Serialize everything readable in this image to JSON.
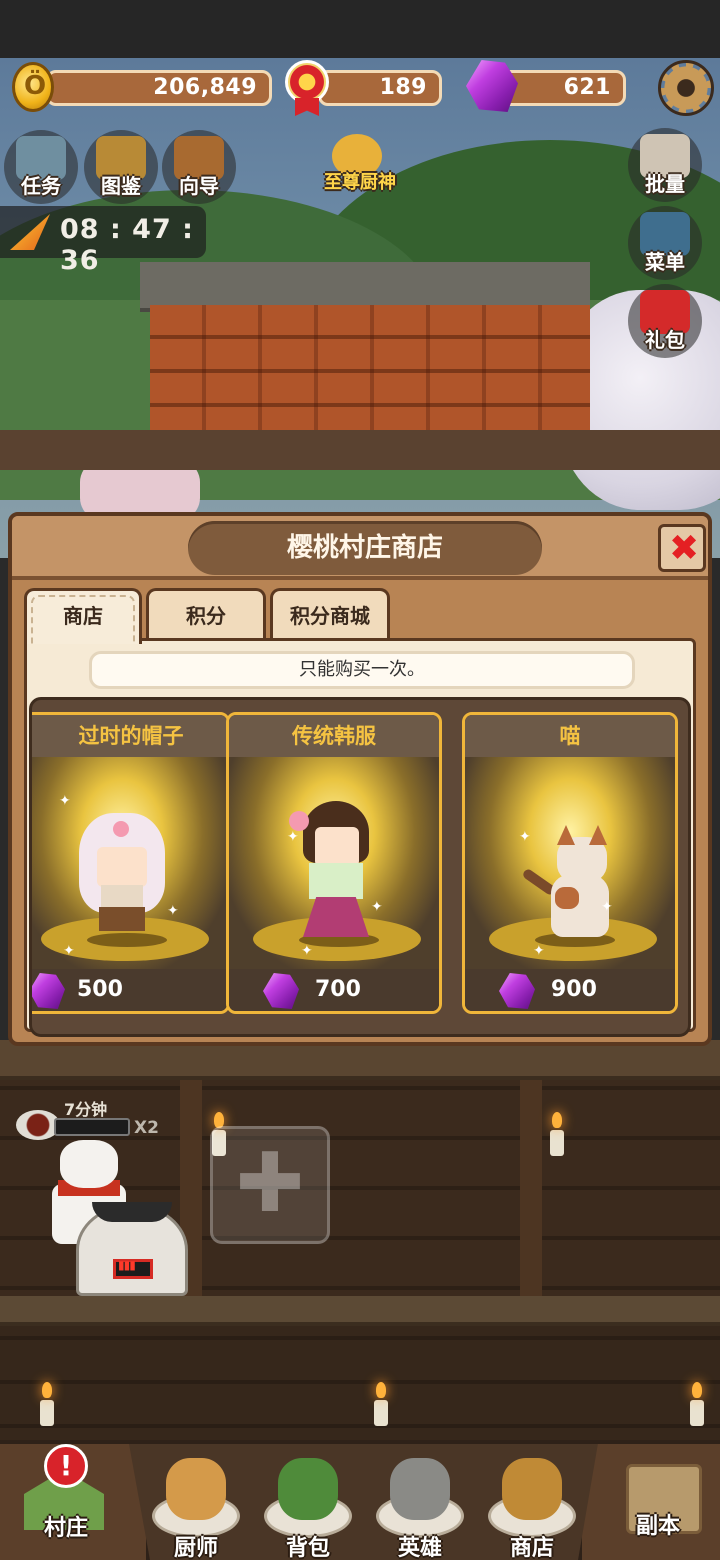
{
  "resources": {
    "gold": "206,849",
    "medals": "189",
    "gems": "621"
  },
  "left_buttons": [
    {
      "label": "任务",
      "icon": "quest-icon"
    },
    {
      "label": "图鉴",
      "icon": "book-icon"
    },
    {
      "label": "向导",
      "icon": "signpost-icon"
    }
  ],
  "center_button": {
    "label": "至尊厨神",
    "icon": "chef-crown-icon"
  },
  "right_buttons": [
    {
      "label": "批量",
      "icon": "bird-icon"
    },
    {
      "label": "菜单",
      "icon": "menu-board-icon"
    },
    {
      "label": "礼包",
      "icon": "gift-icon"
    }
  ],
  "event_timer": "08 : 47 : 36",
  "shop": {
    "title": "樱桃村庄商店",
    "close_symbol": "✖",
    "tabs": [
      "商店",
      "积分",
      "积分商城"
    ],
    "active_tab": 0,
    "notice": "只能购买一次。",
    "items": [
      {
        "name": "过时的帽子",
        "price": "500",
        "currency": "gem"
      },
      {
        "name": "传统韩服",
        "price": "700",
        "currency": "gem"
      },
      {
        "name": "喵",
        "price": "900",
        "currency": "gem"
      }
    ]
  },
  "kitchen": {
    "cook_time": "7分钟",
    "multiplier": "X2",
    "add_symbol": "✚"
  },
  "bottom_nav": {
    "village": {
      "label": "村庄",
      "alert": "!"
    },
    "items": [
      {
        "label": "厨师",
        "icon": "roast-chicken-icon"
      },
      {
        "label": "背包",
        "icon": "backpack-icon"
      },
      {
        "label": "英雄",
        "icon": "hero-helmet-icon"
      },
      {
        "label": "商店",
        "icon": "treasure-chest-icon"
      }
    ],
    "dungeon": {
      "label": "副本"
    }
  },
  "colors": {
    "accent_gold": "#f0b63a",
    "close_red": "#e42023",
    "gem_purple": "#c03ee0",
    "panel_brown": "#b88454"
  }
}
